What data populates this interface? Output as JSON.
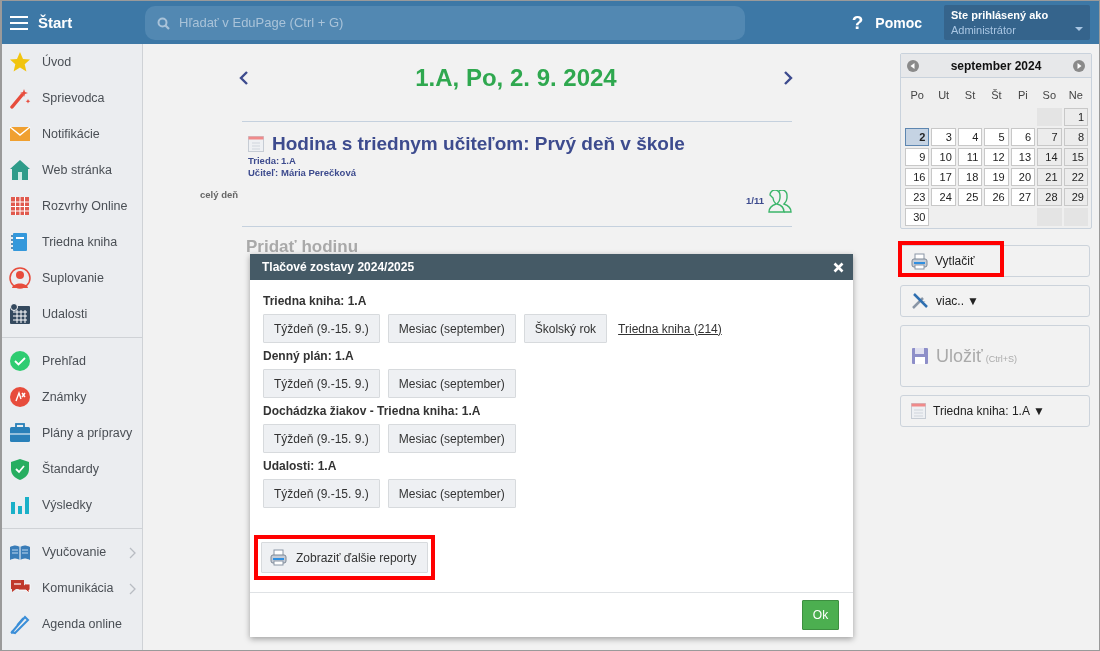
{
  "topbar": {
    "menu_label": "Štart",
    "search_placeholder": "Hľadať v EduPage (Ctrl + G)",
    "help_icon": "?",
    "help": "Pomoc",
    "user_caption": "Ste prihlásený ako",
    "user_name": "Administrátor"
  },
  "sidebar": {
    "groups": [
      [
        {
          "label": "Úvod",
          "submenu": false
        },
        {
          "label": "Sprievodca",
          "submenu": false
        },
        {
          "label": "Notifikácie",
          "submenu": false
        },
        {
          "label": "Web stránka",
          "submenu": false
        },
        {
          "label": "Rozvrhy Online",
          "submenu": false
        },
        {
          "label": "Triedna kniha",
          "submenu": false
        },
        {
          "label": "Suplovanie",
          "submenu": false
        },
        {
          "label": "Udalosti",
          "submenu": false
        }
      ],
      [
        {
          "label": "Prehľad",
          "submenu": false
        },
        {
          "label": "Známky",
          "submenu": false
        },
        {
          "label": "Plány a prípravy",
          "submenu": false
        },
        {
          "label": "Štandardy",
          "submenu": false
        },
        {
          "label": "Výsledky",
          "submenu": false
        }
      ],
      [
        {
          "label": "Vyučovanie",
          "submenu": true
        },
        {
          "label": "Komunikácia",
          "submenu": true
        },
        {
          "label": "Agenda online",
          "submenu": false
        }
      ]
    ]
  },
  "day": {
    "title": "1.A, Po, 2. 9. 2024",
    "all_day": "celý deň",
    "lesson": {
      "title": "Hodina s triednym učiteľom: Prvý deň v škole",
      "fields": [
        {
          "label": "Trieda:",
          "value": "1.A"
        },
        {
          "label": "Učiteľ:",
          "value": "Mária Perečková"
        }
      ],
      "attendance": "1/11"
    },
    "add_lesson": "Pridať hodinu"
  },
  "calendar": {
    "month": "september 2024",
    "weekdays": [
      "Po",
      "Ut",
      "St",
      "Št",
      "Pi",
      "So",
      "Ne"
    ],
    "weeks": [
      [
        {
          "kind": "blank"
        },
        {
          "kind": "blank"
        },
        {
          "kind": "blank"
        },
        {
          "kind": "blank"
        },
        {
          "kind": "blank"
        },
        {
          "kind": "blank"
        },
        {
          "kind": "day",
          "day": "1",
          "selected": false
        }
      ],
      [
        {
          "kind": "day",
          "day": "2",
          "selected": true
        },
        {
          "kind": "day",
          "day": "3",
          "selected": false
        },
        {
          "kind": "day",
          "day": "4",
          "selected": false
        },
        {
          "kind": "day",
          "day": "5",
          "selected": false
        },
        {
          "kind": "day",
          "day": "6",
          "selected": false
        },
        {
          "kind": "day",
          "day": "7",
          "selected": false
        },
        {
          "kind": "day",
          "day": "8",
          "selected": false
        }
      ],
      [
        {
          "kind": "day",
          "day": "9",
          "selected": false
        },
        {
          "kind": "day",
          "day": "10",
          "selected": false
        },
        {
          "kind": "day",
          "day": "11",
          "selected": false
        },
        {
          "kind": "day",
          "day": "12",
          "selected": false
        },
        {
          "kind": "day",
          "day": "13",
          "selected": false
        },
        {
          "kind": "day",
          "day": "14",
          "selected": false
        },
        {
          "kind": "day",
          "day": "15",
          "selected": false
        }
      ],
      [
        {
          "kind": "day",
          "day": "16",
          "selected": false
        },
        {
          "kind": "day",
          "day": "17",
          "selected": false
        },
        {
          "kind": "day",
          "day": "18",
          "selected": false
        },
        {
          "kind": "day",
          "day": "19",
          "selected": false
        },
        {
          "kind": "day",
          "day": "20",
          "selected": false
        },
        {
          "kind": "day",
          "day": "21",
          "selected": false
        },
        {
          "kind": "day",
          "day": "22",
          "selected": false
        }
      ],
      [
        {
          "kind": "day",
          "day": "23",
          "selected": false
        },
        {
          "kind": "day",
          "day": "24",
          "selected": false
        },
        {
          "kind": "day",
          "day": "25",
          "selected": false
        },
        {
          "kind": "day",
          "day": "26",
          "selected": false
        },
        {
          "kind": "day",
          "day": "27",
          "selected": false
        },
        {
          "kind": "day",
          "day": "28",
          "selected": false
        },
        {
          "kind": "day",
          "day": "29",
          "selected": false
        }
      ],
      [
        {
          "kind": "day",
          "day": "30",
          "selected": false
        },
        {
          "kind": "blank"
        },
        {
          "kind": "blank"
        },
        {
          "kind": "blank"
        },
        {
          "kind": "blank"
        },
        {
          "kind": "blank"
        },
        {
          "kind": "blank"
        }
      ]
    ]
  },
  "actions": [
    {
      "kind": "button",
      "label": "Vytlačiť",
      "highlighted": true
    },
    {
      "kind": "menu",
      "label": "viac..",
      "caret": "▼",
      "highlighted": false
    },
    {
      "kind": "save",
      "label": "Uložiť",
      "shortcut": "(Ctrl+S)",
      "highlighted": false
    },
    {
      "kind": "menu",
      "label": "Triedna kniha: 1.A",
      "caret": "▼",
      "highlighted": false
    }
  ],
  "dialog": {
    "title": "Tlačové zostavy 2024/2025",
    "sections": [
      {
        "heading": "Triedna kniha: 1.A",
        "buttons": [
          "Týždeň (9.-15. 9.)",
          "Mesiac (september)",
          "Školský rok"
        ],
        "link": "Triedna kniha (214)"
      },
      {
        "heading": "Denný plán: 1.A",
        "buttons": [
          "Týždeň (9.-15. 9.)",
          "Mesiac (september)"
        ]
      },
      {
        "heading": "Dochádzka žiakov - Triedna kniha: 1.A",
        "buttons": [
          "Týždeň (9.-15. 9.)",
          "Mesiac (september)"
        ]
      },
      {
        "heading": "Udalosti: 1.A",
        "buttons": [
          "Týždeň (9.-15. 9.)",
          "Mesiac (september)"
        ]
      }
    ],
    "more_button": {
      "label": "Zobraziť ďalšie reporty",
      "highlighted": true
    },
    "ok": "Ok"
  }
}
